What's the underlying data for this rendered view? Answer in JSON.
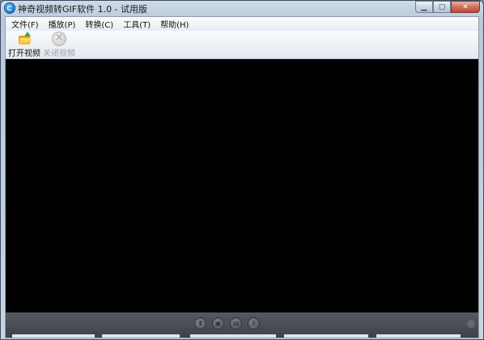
{
  "window": {
    "title": "神奇视频转GIF软件 1.0 - 试用版"
  },
  "caption_buttons": [
    {
      "name": "minimize-button",
      "icon": "minimize-icon"
    },
    {
      "name": "maximize-button",
      "icon": "maximize-icon"
    },
    {
      "name": "close-button",
      "icon": "close-icon"
    }
  ],
  "menu": [
    {
      "label": "文件(F)"
    },
    {
      "label": "播放(P)"
    },
    {
      "label": "转换(C)"
    },
    {
      "label": "工具(T)"
    },
    {
      "label": "帮助(H)"
    }
  ],
  "toolbar": {
    "open_video_label": "打开视频",
    "close_video_label": "关闭视频"
  },
  "player": {
    "background_color": "#000000",
    "controls": [
      "upload-icon",
      "film-icon",
      "filmstrip-icon",
      "pause-icon"
    ]
  }
}
